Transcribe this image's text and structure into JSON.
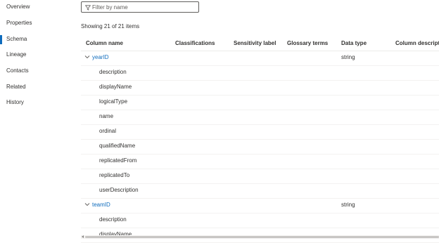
{
  "nav": {
    "items": [
      {
        "label": "Overview",
        "active": false
      },
      {
        "label": "Properties",
        "active": false
      },
      {
        "label": "Schema",
        "active": true
      },
      {
        "label": "Lineage",
        "active": false
      },
      {
        "label": "Contacts",
        "active": false
      },
      {
        "label": "Related",
        "active": false
      },
      {
        "label": "History",
        "active": false
      }
    ]
  },
  "filter": {
    "placeholder": "Filter by name",
    "value": "",
    "icon": "funnel-icon"
  },
  "summary": "Showing 21 of 21 items",
  "table": {
    "headers": [
      "Column name",
      "Classifications",
      "Sensitivity label",
      "Glossary terms",
      "Data type",
      "Column description"
    ],
    "rows": [
      {
        "name": "yearID",
        "type": "parent",
        "data_type": "string",
        "expanded": true
      },
      {
        "name": "description",
        "type": "child",
        "data_type": ""
      },
      {
        "name": "displayName",
        "type": "child",
        "data_type": ""
      },
      {
        "name": "logicalType",
        "type": "child",
        "data_type": ""
      },
      {
        "name": "name",
        "type": "child",
        "data_type": ""
      },
      {
        "name": "ordinal",
        "type": "child",
        "data_type": ""
      },
      {
        "name": "qualifiedName",
        "type": "child",
        "data_type": ""
      },
      {
        "name": "replicatedFrom",
        "type": "child",
        "data_type": ""
      },
      {
        "name": "replicatedTo",
        "type": "child",
        "data_type": ""
      },
      {
        "name": "userDescription",
        "type": "child",
        "data_type": ""
      },
      {
        "name": "teamID",
        "type": "parent",
        "data_type": "string",
        "expanded": true
      },
      {
        "name": "description",
        "type": "child",
        "data_type": ""
      },
      {
        "name": "displayName",
        "type": "child",
        "data_type": ""
      }
    ]
  },
  "colors": {
    "accent": "#0f6cbd",
    "text": "#323130",
    "border": "#edebe9"
  }
}
